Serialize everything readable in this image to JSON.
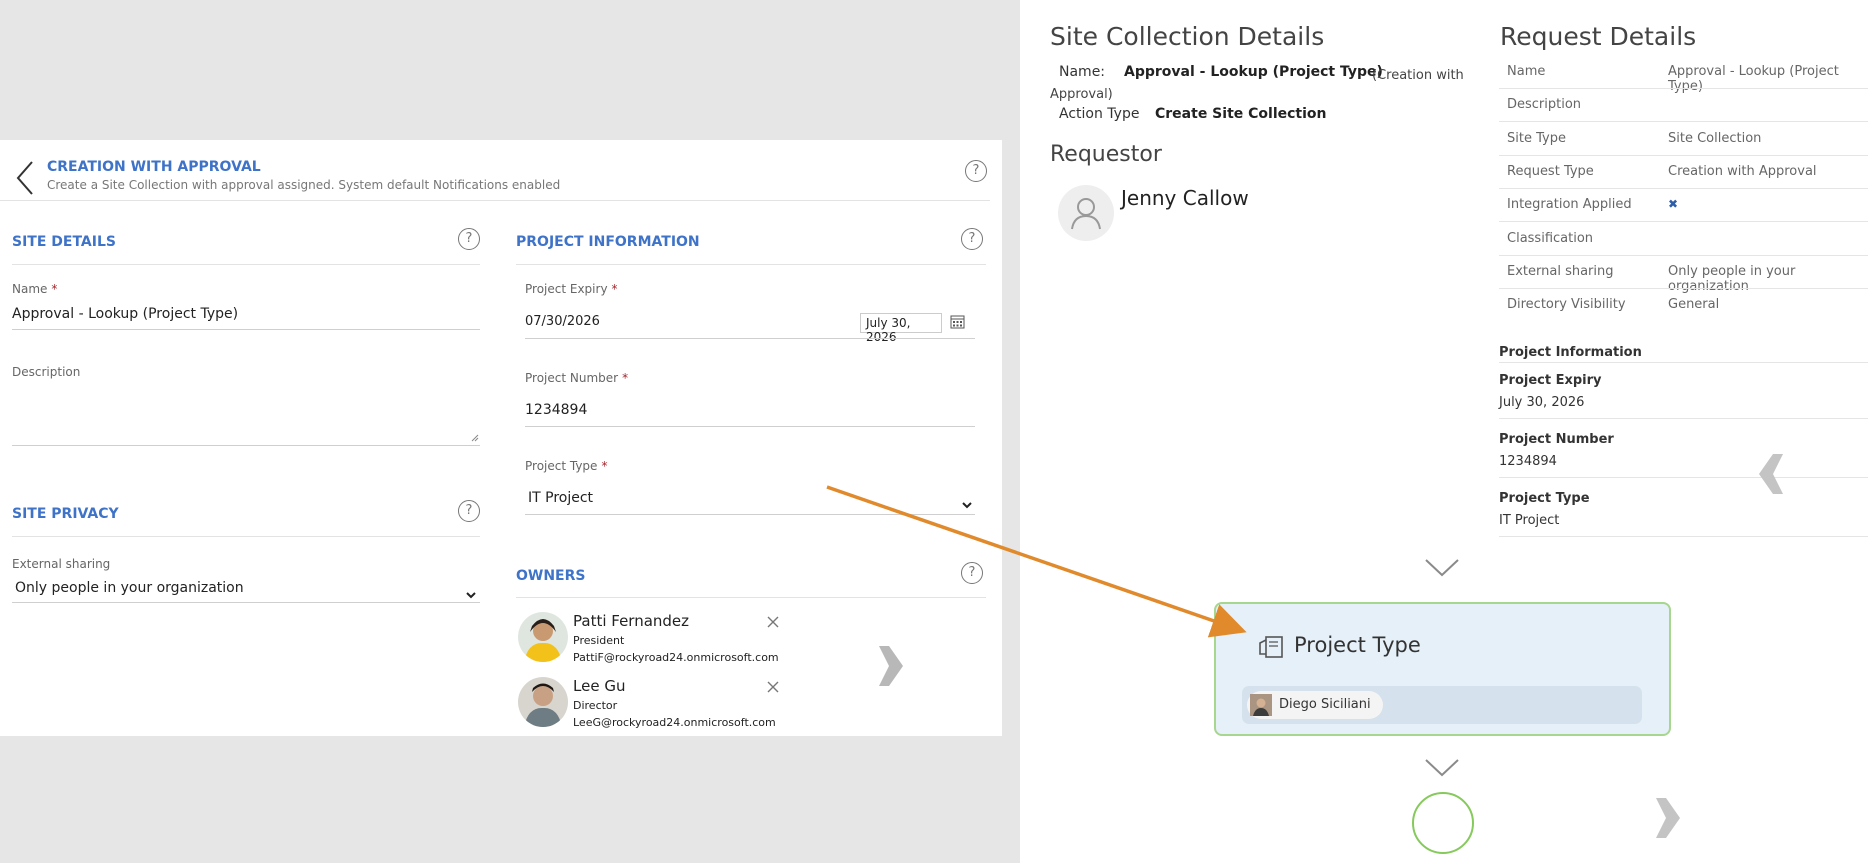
{
  "form": {
    "title": "CREATION WITH APPROVAL",
    "subtitle": "Create a Site Collection with approval assigned. System default Notifications enabled",
    "site_details": {
      "title": "SITE DETAILS",
      "name_label": "Name",
      "name_value": "Approval - Lookup (Project Type)",
      "description_label": "Description"
    },
    "site_privacy": {
      "title": "SITE PRIVACY",
      "external_sharing_label": "External sharing",
      "external_sharing_value": "Only people in your organization"
    },
    "project_information": {
      "title": "PROJECT INFORMATION",
      "expiry_label": "Project Expiry",
      "expiry_value": "07/30/2026",
      "expiry_display": "July 30, 2026",
      "number_label": "Project Number",
      "number_value": "1234894",
      "type_label": "Project Type",
      "type_value": "IT Project"
    },
    "owners": {
      "title": "OWNERS",
      "list": [
        {
          "name": "Patti Fernandez",
          "role": "President",
          "email": "PattiF@rockyroad24.onmicrosoft.com"
        },
        {
          "name": "Lee Gu",
          "role": "Director",
          "email": "LeeG@rockyroad24.onmicrosoft.com"
        }
      ]
    },
    "help_glyph": "?"
  },
  "site_collection": {
    "title": "Site Collection Details",
    "name_label": "Name:",
    "name_value": "Approval - Lookup (Project Type)",
    "name_note": "(Creation with Approval)",
    "action_label": "Action Type",
    "action_value": "Create Site Collection"
  },
  "requestor": {
    "title": "Requestor",
    "name": "Jenny Callow"
  },
  "request_details": {
    "title": "Request Details",
    "rows": [
      {
        "label": "Name",
        "value": "Approval - Lookup (Project Type)"
      },
      {
        "label": "Description",
        "value": ""
      },
      {
        "label": "Site Type",
        "value": "Site Collection"
      },
      {
        "label": "Request Type",
        "value": "Creation with Approval"
      },
      {
        "label": "Integration Applied",
        "value": "✖"
      },
      {
        "label": "Classification",
        "value": ""
      },
      {
        "label": "External sharing",
        "value": "Only people in your organization"
      },
      {
        "label": "Directory Visibility",
        "value": "General"
      }
    ],
    "project_information_title": "Project Information",
    "project_fields": [
      {
        "label": "Project Expiry",
        "value": "July 30, 2026"
      },
      {
        "label": "Project Number",
        "value": "1234894"
      },
      {
        "label": "Project Type",
        "value": "IT Project"
      }
    ]
  },
  "workflow_node": {
    "title": "Project Type",
    "assignee": "Diego Siciliani"
  },
  "colors": {
    "accent": "#3e73c8",
    "required": "#a4262c",
    "arrow": "#e08a2c",
    "node_fill": "#e6f0f9",
    "node_border": "#a7d68e",
    "end_circle": "#86c95c"
  },
  "icons": [
    "back-chevron-icon",
    "help-icon",
    "calendar-icon",
    "dropdown-chevron-icon",
    "close-icon",
    "user-placeholder-icon",
    "copy-icon",
    "down-chevron-icon",
    "nav-arrow-icon",
    "integration-x-icon"
  ]
}
